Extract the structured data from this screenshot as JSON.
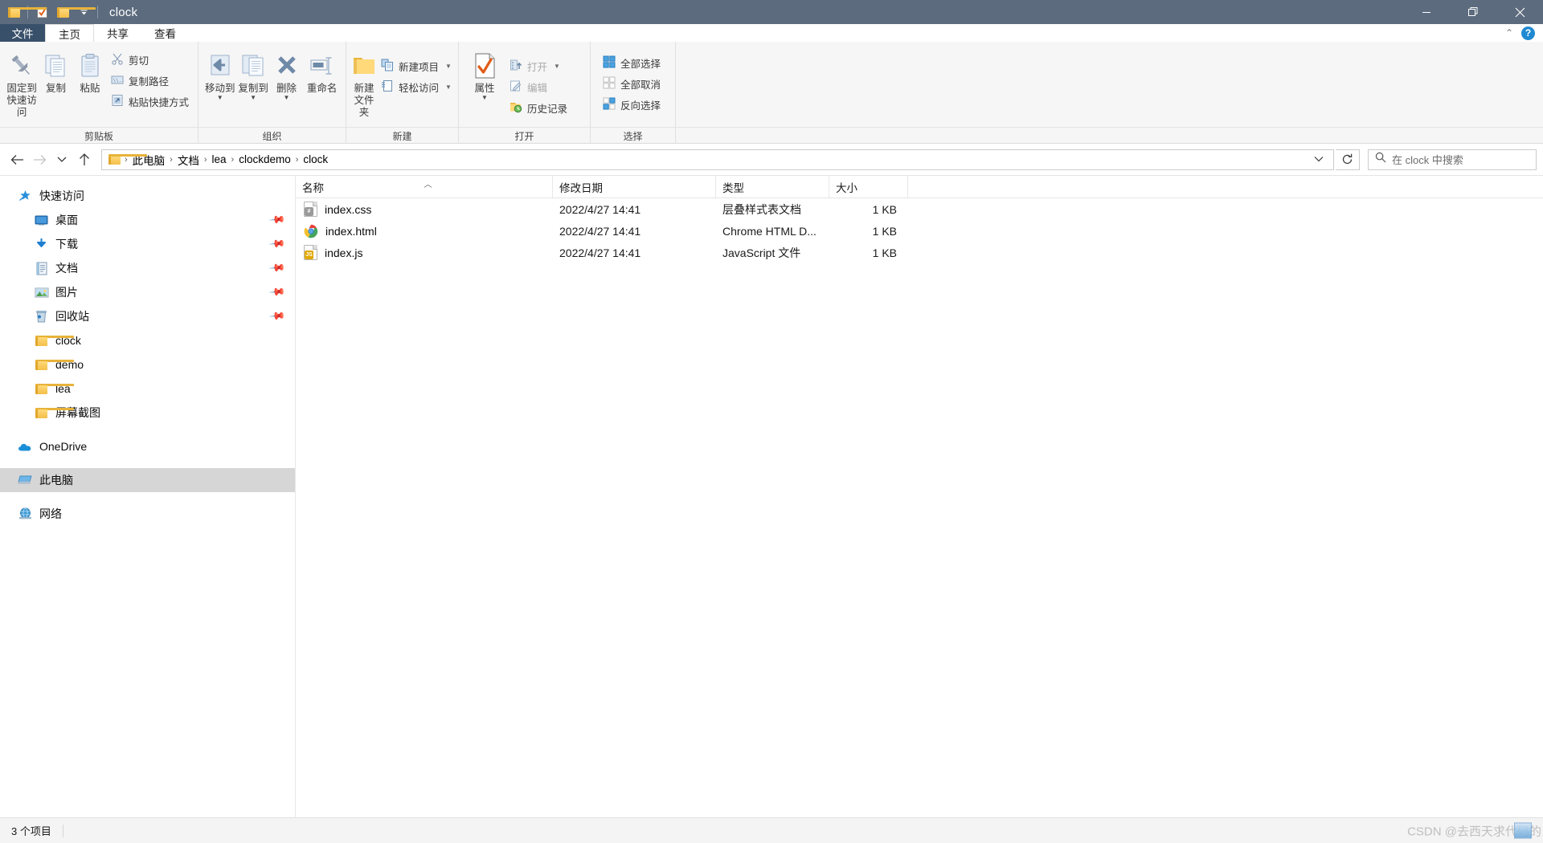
{
  "window": {
    "title": "clock",
    "quick_access_icons": [
      "folder-icon",
      "properties-check-icon",
      "new-folder-icon",
      "customize-caret-icon"
    ],
    "controls": {
      "minimize": "—",
      "maximize": "❐",
      "close": "✕"
    }
  },
  "tabs": {
    "file": "文件",
    "items": [
      {
        "label": "主页",
        "active": true
      },
      {
        "label": "共享",
        "active": false
      },
      {
        "label": "查看",
        "active": false
      }
    ],
    "collapse_caret": "⌃",
    "help": "?"
  },
  "ribbon": {
    "groups": [
      {
        "label": "剪贴板",
        "big_buttons": [
          {
            "name": "pin-to-quick-access",
            "line1": "固定到",
            "line2": "快速访问",
            "icon": "pin-icon"
          },
          {
            "name": "copy",
            "line1": "复制",
            "line2": "",
            "icon": "copy-icon"
          },
          {
            "name": "paste",
            "line1": "粘贴",
            "line2": "",
            "icon": "paste-icon"
          }
        ],
        "small_buttons": [
          {
            "name": "cut",
            "label": "剪切",
            "icon": "scissors-icon",
            "disabled": false
          },
          {
            "name": "copy-path",
            "label": "复制路径",
            "icon": "copy-path-icon",
            "disabled": false
          },
          {
            "name": "paste-shortcut",
            "label": "粘贴快捷方式",
            "icon": "paste-shortcut-icon",
            "disabled": false
          }
        ]
      },
      {
        "label": "组织",
        "big_buttons": [
          {
            "name": "move-to",
            "line1": "移动到",
            "line2": "",
            "icon": "move-to-icon",
            "caret": true
          },
          {
            "name": "copy-to",
            "line1": "复制到",
            "line2": "",
            "icon": "copy-to-icon",
            "caret": true
          },
          {
            "name": "delete",
            "line1": "删除",
            "line2": "",
            "icon": "delete-x-icon",
            "caret": true
          },
          {
            "name": "rename",
            "line1": "重命名",
            "line2": "",
            "icon": "rename-icon"
          }
        ],
        "small_buttons": []
      },
      {
        "label": "新建",
        "big_buttons": [
          {
            "name": "new-folder",
            "line1": "新建",
            "line2": "文件夹",
            "icon": "new-folder-icon"
          }
        ],
        "small_buttons": [
          {
            "name": "new-item",
            "label": "新建项目",
            "icon": "new-item-icon",
            "caret": true
          },
          {
            "name": "easy-access",
            "label": "轻松访问",
            "icon": "easy-access-icon",
            "caret": true
          }
        ]
      },
      {
        "label": "打开",
        "big_buttons": [
          {
            "name": "properties",
            "line1": "属性",
            "line2": "",
            "icon": "properties-check-icon",
            "caret": true
          }
        ],
        "small_buttons": [
          {
            "name": "open",
            "label": "打开",
            "icon": "open-icon",
            "caret": true,
            "disabled": true
          },
          {
            "name": "edit",
            "label": "编辑",
            "icon": "edit-icon",
            "disabled": true
          },
          {
            "name": "history",
            "label": "历史记录",
            "icon": "history-icon",
            "disabled": false
          }
        ]
      },
      {
        "label": "选择",
        "big_buttons": [],
        "small_buttons": [
          {
            "name": "select-all",
            "label": "全部选择",
            "icon": "select-all-icon"
          },
          {
            "name": "select-none",
            "label": "全部取消",
            "icon": "select-none-icon"
          },
          {
            "name": "invert-selection",
            "label": "反向选择",
            "icon": "invert-selection-icon"
          }
        ]
      }
    ]
  },
  "navbar": {
    "back": "←",
    "forward": "→",
    "recent": "⌄",
    "up": "↑",
    "breadcrumbs": [
      "此电脑",
      "文档",
      "lea",
      "clockdemo",
      "clock"
    ],
    "separator": "›",
    "dropdown_caret": "⌄",
    "refresh": "↻",
    "search_placeholder": "在 clock 中搜索"
  },
  "sidebar": {
    "groups": [
      {
        "header": {
          "label": "快速访问",
          "icon": "star-pin-icon"
        },
        "items": [
          {
            "label": "桌面",
            "icon": "desktop-icon",
            "pinned": true
          },
          {
            "label": "下载",
            "icon": "downloads-icon",
            "pinned": true
          },
          {
            "label": "文档",
            "icon": "documents-icon",
            "pinned": true
          },
          {
            "label": "图片",
            "icon": "pictures-icon",
            "pinned": true
          },
          {
            "label": "回收站",
            "icon": "recycle-bin-icon",
            "pinned": true
          },
          {
            "label": "clock",
            "icon": "folder-icon",
            "pinned": false
          },
          {
            "label": "demo",
            "icon": "folder-icon",
            "pinned": false
          },
          {
            "label": "lea",
            "icon": "folder-icon",
            "pinned": false
          },
          {
            "label": "屏幕截图",
            "icon": "folder-icon",
            "pinned": false
          }
        ]
      },
      {
        "header": null,
        "items": [
          {
            "label": "OneDrive",
            "icon": "onedrive-icon",
            "pinned": false,
            "root": true
          }
        ]
      },
      {
        "header": null,
        "items": [
          {
            "label": "此电脑",
            "icon": "this-pc-icon",
            "pinned": false,
            "root": true,
            "selected": true
          }
        ]
      },
      {
        "header": null,
        "items": [
          {
            "label": "网络",
            "icon": "network-icon",
            "pinned": false,
            "root": true
          }
        ]
      }
    ]
  },
  "filelist": {
    "columns": [
      {
        "label": "名称",
        "sorted": "asc"
      },
      {
        "label": "修改日期",
        "sorted": null
      },
      {
        "label": "类型",
        "sorted": null
      },
      {
        "label": "大小",
        "sorted": null
      }
    ],
    "rows": [
      {
        "name": "index.css",
        "date": "2022/4/27 14:41",
        "type": "层叠样式表文档",
        "size": "1 KB",
        "icon": "css-file-icon"
      },
      {
        "name": "index.html",
        "date": "2022/4/27 14:41",
        "type": "Chrome HTML D...",
        "size": "1 KB",
        "icon": "chrome-file-icon"
      },
      {
        "name": "index.js",
        "date": "2022/4/27 14:41",
        "type": "JavaScript 文件",
        "size": "1 KB",
        "icon": "js-file-icon"
      }
    ]
  },
  "statusbar": {
    "count": "3 个项目",
    "watermark": "CSDN @去西天求代码的"
  },
  "colors": {
    "titlebar": "#5c6b7d",
    "file_tab": "#39506b",
    "ribbon_bg": "#f6f6f6",
    "accent_blue": "#1f8ad2",
    "selection": "#d6d6d6",
    "folder_yellow": "#f3bf49",
    "orange_check": "#e05c17"
  }
}
